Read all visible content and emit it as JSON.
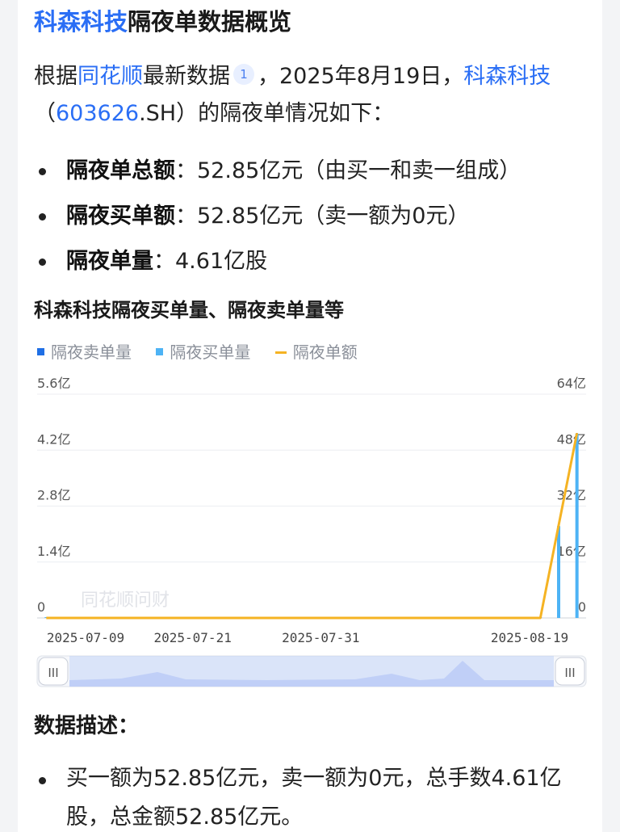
{
  "header": {
    "title_company": "科森科技",
    "title_rest": "隔夜单数据概览"
  },
  "intro": {
    "p1": "根据",
    "source": "同花顺",
    "p2": "最新数据",
    "ref": "1",
    "p3": "，2025年8月19日，",
    "company": "科森科技",
    "p4": "（",
    "code": "603626",
    "p5": ".SH）的隔夜单情况如下："
  },
  "facts": [
    {
      "label": "隔夜单总额",
      "value": "：52.85亿元（由买一和卖一组成）"
    },
    {
      "label": "隔夜买单额",
      "value": "：52.85亿元（卖一额为0元）"
    },
    {
      "label": "隔夜单量",
      "value": "：4.61亿股"
    }
  ],
  "chart_data": {
    "type": "bar",
    "title": "科森科技隔夜买单量、隔夜卖单量等",
    "watermark": "同花顺问财",
    "legend": [
      {
        "name": "隔夜卖单量",
        "color": "#1f6fe5",
        "kind": "bar"
      },
      {
        "name": "隔夜买单量",
        "color": "#4db3f5",
        "kind": "bar"
      },
      {
        "name": "隔夜单额",
        "color": "#f5b323",
        "kind": "line"
      }
    ],
    "x_tick_labels": [
      "2025-07-09",
      "2025-07-21",
      "2025-07-31",
      "2025-08-19"
    ],
    "y_left": {
      "ticks": [
        "0",
        "1.4亿",
        "2.8亿",
        "4.2亿",
        "5.6亿"
      ],
      "min": 0,
      "max": 5.6,
      "unit": "亿股"
    },
    "y_right": {
      "ticks": [
        "0",
        "16亿",
        "32亿",
        "48亿",
        "64亿"
      ],
      "min": 0,
      "max": 64,
      "unit": "亿元"
    },
    "x_count": 30,
    "series": [
      {
        "name": "隔夜买单量",
        "axis": "left",
        "points": [
          [
            0,
            0.02
          ],
          [
            28,
            2.3
          ],
          [
            29,
            4.61
          ]
        ]
      },
      {
        "name": "隔夜卖单量",
        "axis": "left",
        "points": [
          [
            27,
            0.01
          ]
        ]
      },
      {
        "name": "隔夜单额",
        "axis": "right",
        "points": [
          [
            0,
            0
          ],
          [
            27,
            0
          ],
          [
            28,
            26.5
          ],
          [
            29,
            52.85
          ]
        ]
      }
    ],
    "grid": true,
    "zoom_slider": true,
    "slider_handle": "III"
  },
  "description": {
    "title": "数据描述：",
    "items": [
      "买一额为52.85亿元，卖一额为0元，总手数4.61亿股，总金额52.85亿元。"
    ]
  }
}
